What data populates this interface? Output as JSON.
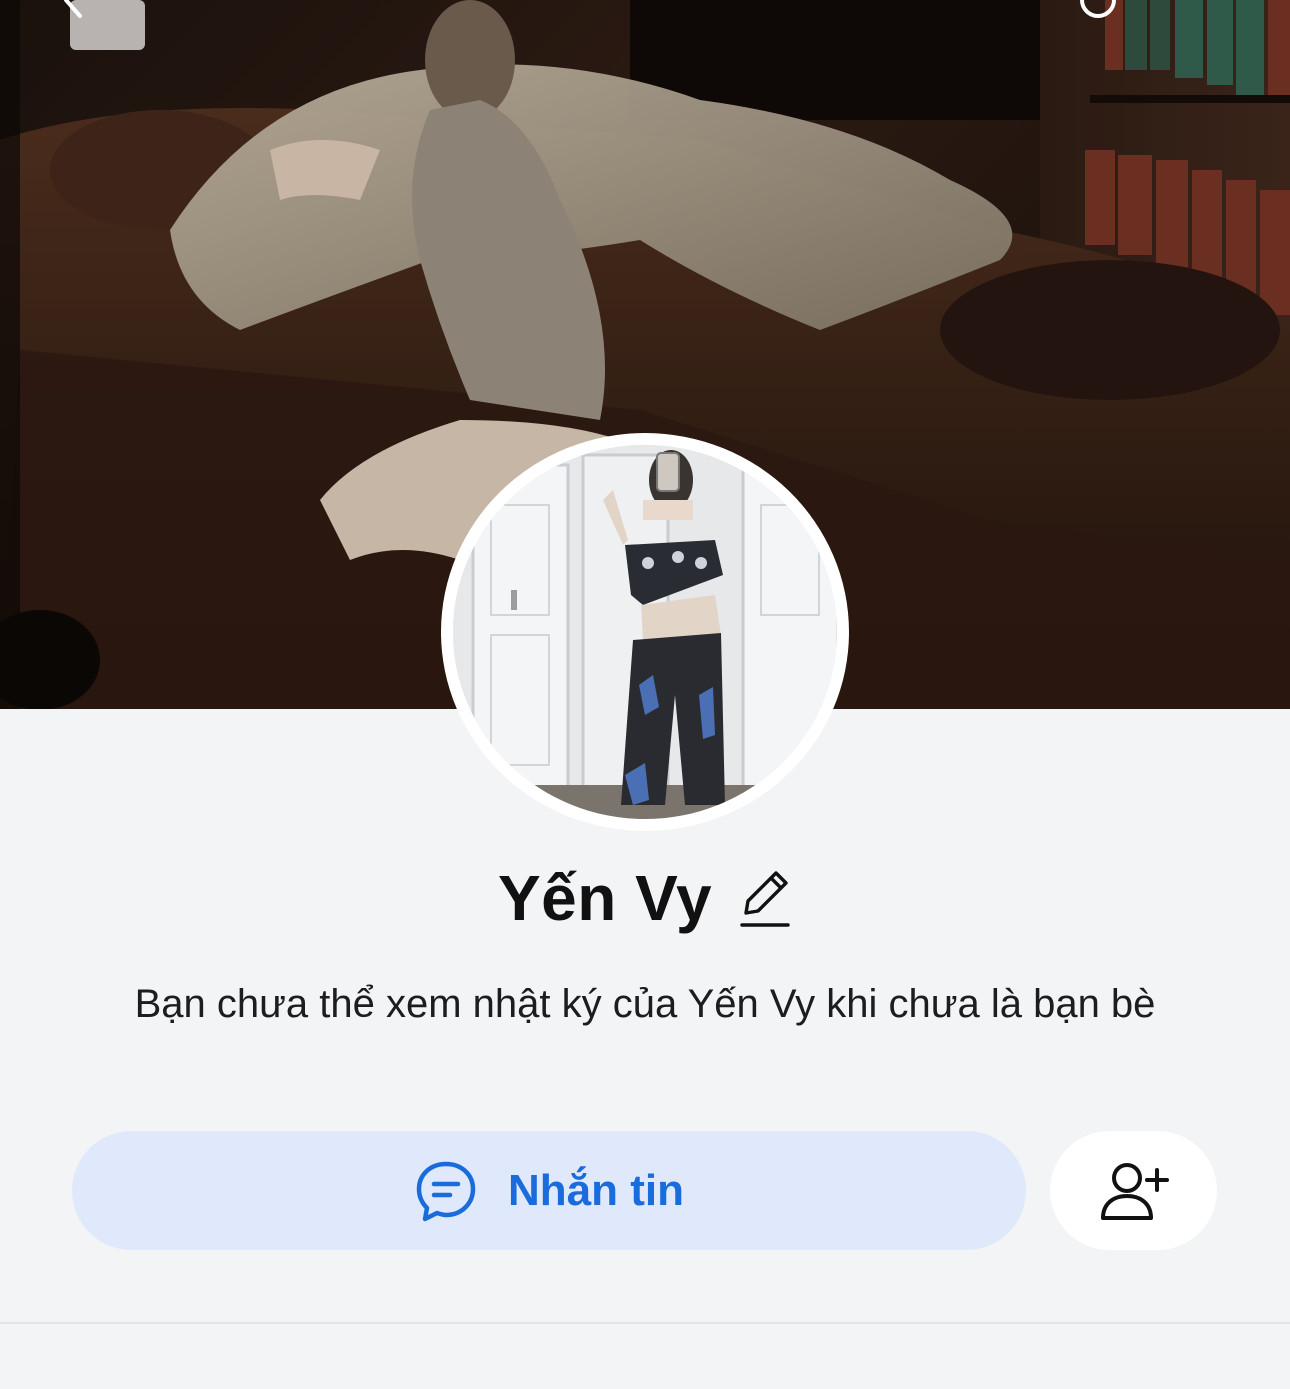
{
  "profile": {
    "name": "Yến Vy",
    "privacy_message": "Bạn chưa thể xem nhật ký của Yến Vy khi chưa là bạn bè"
  },
  "actions": {
    "message_label": "Nhắn tin",
    "message_icon": "chat-bubble-icon",
    "add_friend_icon": "add-friend-icon",
    "edit_icon": "pencil-icon"
  },
  "colors": {
    "background": "#f3f4f6",
    "primary": "#1a6cdc",
    "message_button_bg": "#dfe9fb",
    "add_friend_bg": "#ffffff"
  }
}
